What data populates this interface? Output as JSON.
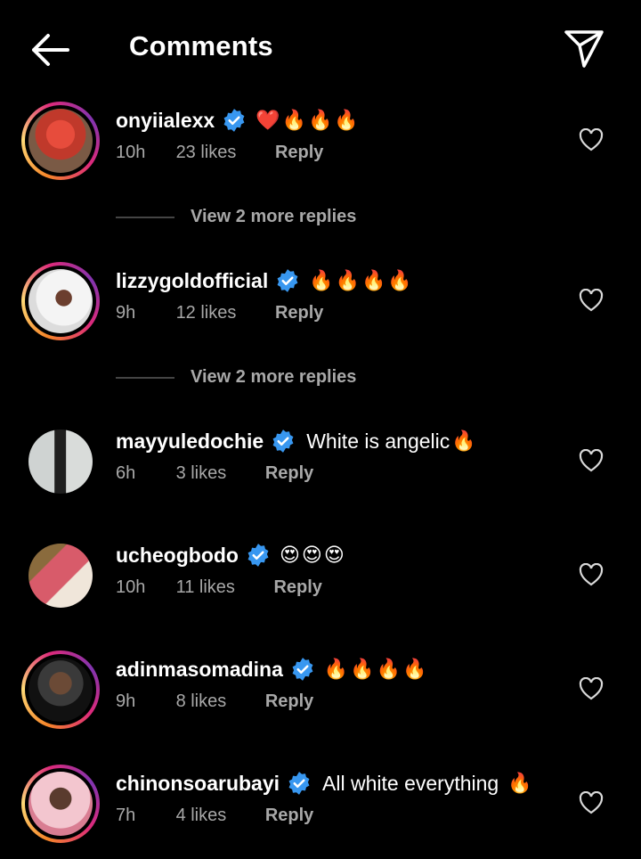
{
  "header": {
    "title": "Comments"
  },
  "comments": [
    {
      "username": "onyiialexx",
      "text": "",
      "emojis": "❤️🔥🔥🔥",
      "time": "10h",
      "likes": "23 likes",
      "reply": "Reply",
      "story_ring": true,
      "avatar_colors": [
        "#c0392b",
        "#e74c3c"
      ]
    },
    {
      "username": "lizzygoldofficial",
      "text": "",
      "emojis": "🔥🔥🔥🔥",
      "time": "9h",
      "likes": "12 likes",
      "reply": "Reply",
      "story_ring": true,
      "avatar_colors": [
        "#dcdcdc",
        "#f4f4f4"
      ]
    },
    {
      "username": "mayyuledochie",
      "text": "White is angelic",
      "emojis": "🔥",
      "time": "6h",
      "likes": "3 likes",
      "reply": "Reply",
      "story_ring": false,
      "avatar_colors": [
        "#cfd3d2",
        "#222222"
      ]
    },
    {
      "username": "ucheogbodo",
      "text": "",
      "emojis": "😍😍😍",
      "time": "10h",
      "likes": "11 likes",
      "reply": "Reply",
      "story_ring": false,
      "avatar_colors": [
        "#d85b6a",
        "#b97f3c"
      ]
    },
    {
      "username": "adinmasomadina",
      "text": "",
      "emojis": "🔥🔥🔥🔥",
      "time": "9h",
      "likes": "8 likes",
      "reply": "Reply",
      "story_ring": true,
      "avatar_colors": [
        "#1a1a1a",
        "#3a3a3a"
      ]
    },
    {
      "username": "chinonsoarubayi",
      "text": "All white everything",
      "emojis": "🔥",
      "time": "7h",
      "likes": "4 likes",
      "reply": "Reply",
      "story_ring": true,
      "avatar_colors": [
        "#f3c6cf",
        "#d97d92"
      ]
    }
  ],
  "view_more": [
    {
      "label": "View 2 more replies"
    },
    {
      "label": "View 2 more replies"
    }
  ],
  "colors": {
    "background": "#000000",
    "text": "#ffffff",
    "muted": "#a8a8a8",
    "verified": "#3897f0"
  },
  "icons": {
    "back": "arrow-left-icon",
    "send": "paper-plane-icon",
    "like": "heart-outline-icon",
    "verified": "verified-badge-icon"
  }
}
